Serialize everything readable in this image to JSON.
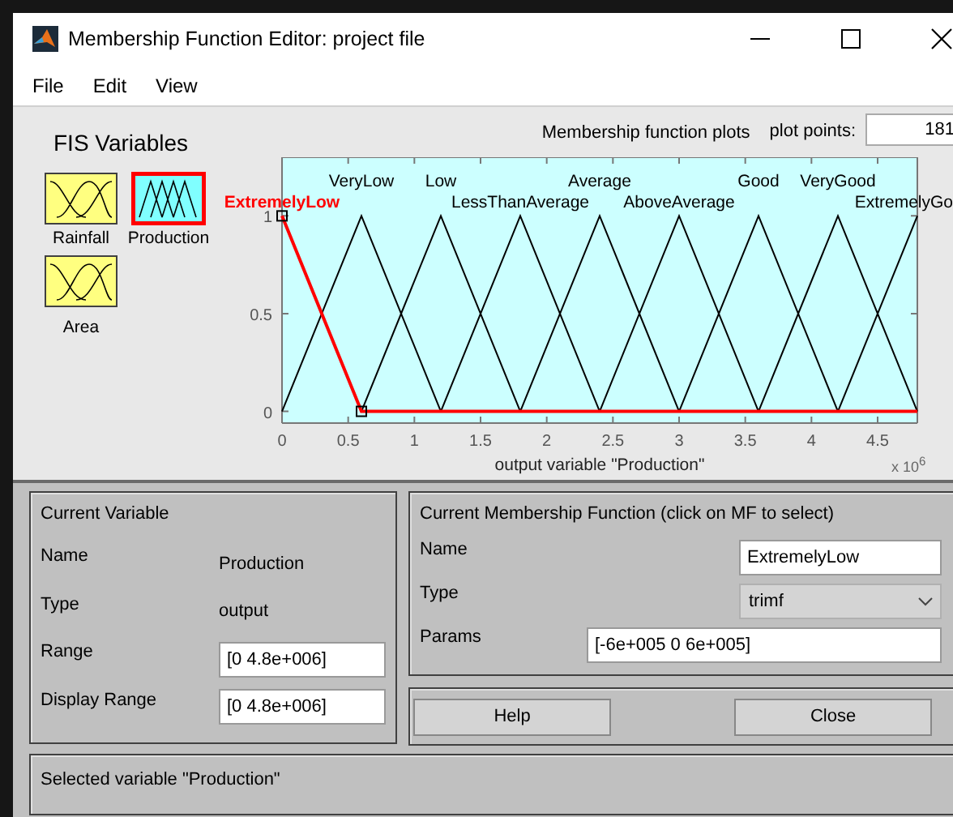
{
  "window": {
    "title": "Membership Function Editor: project file"
  },
  "menu": [
    "File",
    "Edit",
    "View"
  ],
  "fis_variables": {
    "title": "FIS Variables",
    "variables": [
      {
        "label": "Rainfall",
        "kind": "input",
        "selected": false
      },
      {
        "label": "Production",
        "kind": "output",
        "selected": true
      },
      {
        "label": "Area",
        "kind": "input",
        "selected": false
      }
    ]
  },
  "plot": {
    "plot_points_label": "plot points:",
    "plot_points": "181",
    "chart_data": {
      "type": "line",
      "title": "Membership function plots",
      "xlabel": "output variable \"Production\"",
      "x": [
        0,
        0.6,
        1.2,
        1.8,
        2.4,
        3.0,
        3.6,
        4.2,
        4.8
      ],
      "xlim": [
        0,
        4.8
      ],
      "ylim": [
        -0.06,
        1.3
      ],
      "xticks": [
        0,
        0.5,
        1,
        1.5,
        2,
        2.5,
        3,
        3.5,
        4,
        4.5
      ],
      "yticks": [
        0,
        0.5,
        1
      ],
      "annotations": [
        {
          "text": "x 10$^{6}$"
        }
      ],
      "series": [
        {
          "name": "ExtremelyLow",
          "color": "#ff0000",
          "values": [
            1,
            0,
            0,
            0,
            0,
            0,
            0,
            0,
            0
          ]
        },
        {
          "name": "VeryLow",
          "color": "#000000",
          "values": [
            0,
            1,
            0,
            null,
            null,
            null,
            null,
            null,
            null
          ]
        },
        {
          "name": "Low",
          "color": "#000000",
          "values": [
            null,
            0,
            1,
            0,
            null,
            null,
            null,
            null,
            null
          ]
        },
        {
          "name": "LessThanAverage",
          "color": "#000000",
          "values": [
            null,
            null,
            0,
            1,
            0,
            null,
            null,
            null,
            null
          ]
        },
        {
          "name": "Average",
          "color": "#000000",
          "values": [
            null,
            null,
            null,
            0,
            1,
            0,
            null,
            null,
            null
          ]
        },
        {
          "name": "AboveAverage",
          "color": "#000000",
          "values": [
            null,
            null,
            null,
            null,
            0,
            1,
            0,
            null,
            null
          ]
        },
        {
          "name": "Good",
          "color": "#000000",
          "values": [
            null,
            null,
            null,
            null,
            null,
            0,
            1,
            0,
            null
          ]
        },
        {
          "name": "VeryGood",
          "color": "#000000",
          "values": [
            null,
            null,
            null,
            null,
            null,
            null,
            0,
            1,
            0
          ]
        },
        {
          "name": "ExtremelyGo",
          "color": "#000000",
          "values": [
            null,
            null,
            null,
            null,
            null,
            null,
            null,
            0,
            1
          ]
        }
      ]
    }
  },
  "current_variable": {
    "title": "Current Variable",
    "fields": [
      {
        "label": "Name",
        "value": "Production",
        "kind": "text"
      },
      {
        "label": "Type",
        "value": "output",
        "kind": "text"
      },
      {
        "label": "Range",
        "value": "[0 4.8e+006]",
        "kind": "field"
      },
      {
        "label": "Display Range",
        "value": "[0 4.8e+006]",
        "kind": "field"
      }
    ]
  },
  "current_mf": {
    "title": "Current Membership Function (click on MF to select)",
    "name_label": "Name",
    "name": "ExtremelyLow",
    "type_label": "Type",
    "type": "trimf",
    "params_label": "Params",
    "params": "[-6e+005 0 6e+005]"
  },
  "buttons": [
    "Help",
    "Close"
  ],
  "status_bar": "Selected variable \"Production\""
}
